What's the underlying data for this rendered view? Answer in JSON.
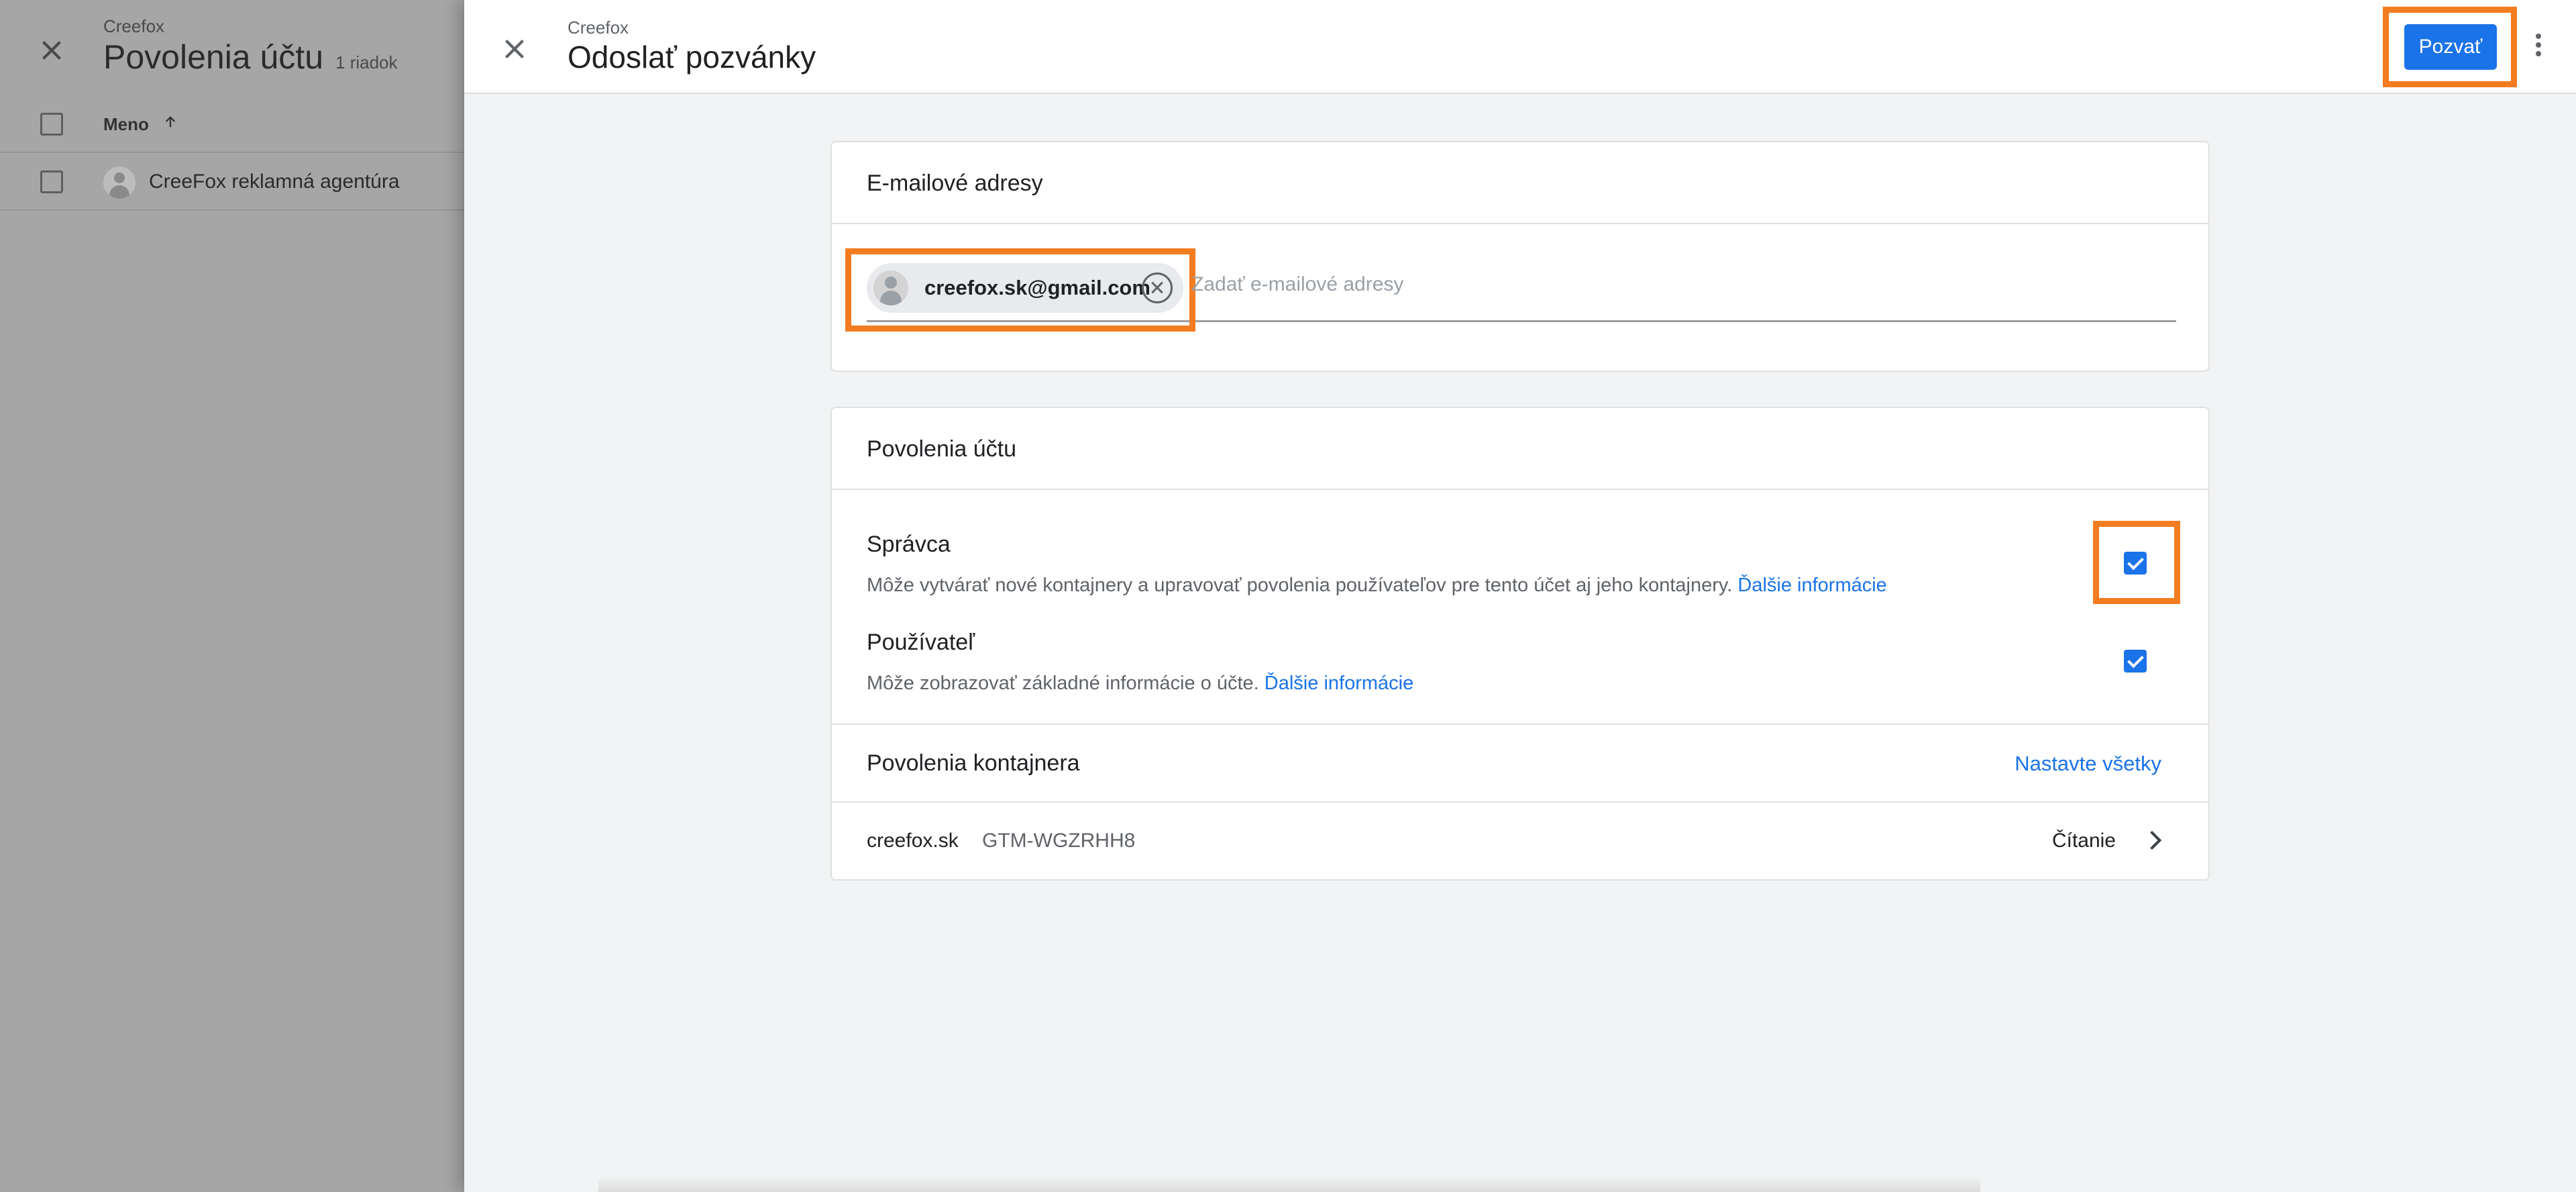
{
  "background": {
    "subtitle": "Creefox",
    "title": "Povolenia účtu",
    "row_count": "1 riadok",
    "column_header": "Meno",
    "sort_icon": "arrow-up-icon",
    "rows": [
      {
        "label": "CreeFox reklamná agentúra"
      }
    ]
  },
  "dialog": {
    "subtitle": "Creefox",
    "title": "Odoslať pozvánky",
    "invite_label": "Pozvať",
    "email_section": {
      "heading": "E-mailové adresy",
      "chips": [
        {
          "email": "creefox.sk@gmail.com"
        }
      ],
      "placeholder": "Zadať e-mailové adresy"
    },
    "account_permissions": {
      "heading": "Povolenia účtu",
      "items": [
        {
          "title": "Správca",
          "description": "Môže vytvárať nové kontajnery a upravovať povolenia používateľov pre tento účet aj jeho kontajnery.",
          "link": "Ďalšie informácie",
          "checked": true
        },
        {
          "title": "Používateľ",
          "description": "Môže zobrazovať základné informácie o účte.",
          "link": "Ďalšie informácie",
          "checked": true
        }
      ]
    },
    "container_permissions": {
      "heading": "Povolenia kontajnera",
      "set_all_label": "Nastavte všetky",
      "rows": [
        {
          "name": "creefox.sk",
          "id": "GTM-WGZRHH8",
          "role": "Čítanie"
        }
      ]
    }
  },
  "colors": {
    "accent": "#1a73e8",
    "highlight": "#f47c20"
  }
}
